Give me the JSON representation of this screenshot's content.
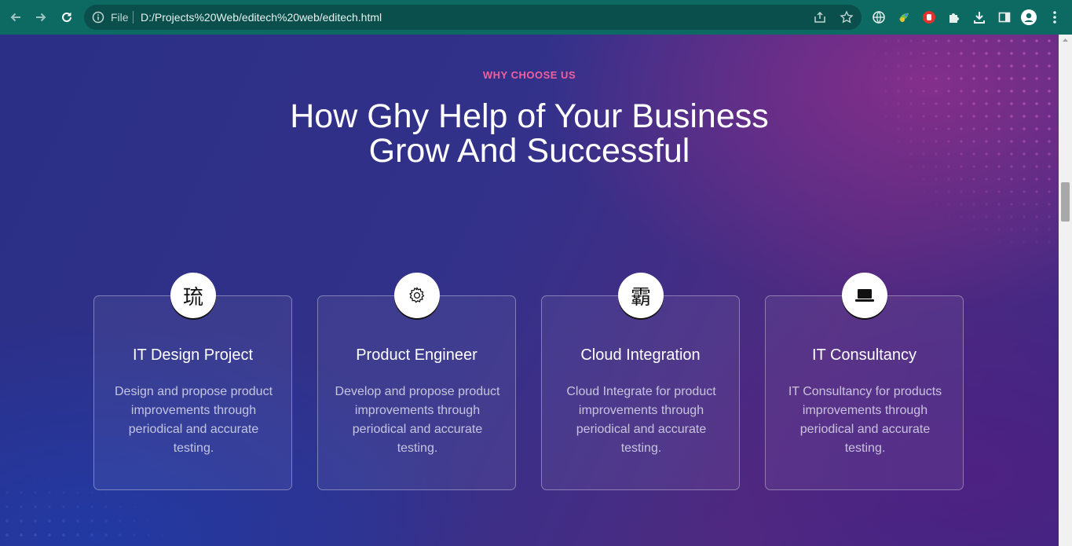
{
  "browser": {
    "file_label": "File",
    "url": "D:/Projects%20Web/editech%20web/editech.html",
    "colors": {
      "toolbar": "#0c6a63",
      "omnibox": "#0a4f4c"
    }
  },
  "section": {
    "eyebrow": "WHY CHOOSE US",
    "headline_line1": "How Ghy Help of Your Business",
    "headline_line2": "Grow And Successful"
  },
  "cards": [
    {
      "icon": "琉",
      "icon_name": "design-icon",
      "title": "IT Design Project",
      "desc": "Design and propose product improvements through periodical and accurate testing."
    },
    {
      "icon": "",
      "icon_name": "gear-icon",
      "title": "Product Engineer",
      "desc": "Develop and propose product improvements through periodical and accurate testing."
    },
    {
      "icon": "霸",
      "icon_name": "cloud-icon",
      "title": "Cloud Integration",
      "desc": "Cloud Integrate for product improvements through periodical and accurate testing."
    },
    {
      "icon": "",
      "icon_name": "laptop-icon",
      "title": "IT Consultancy",
      "desc": "IT Consultancy for products improvements through periodical and accurate testing."
    }
  ],
  "colors": {
    "accent": "#f0609e",
    "text": "#ffffff"
  }
}
